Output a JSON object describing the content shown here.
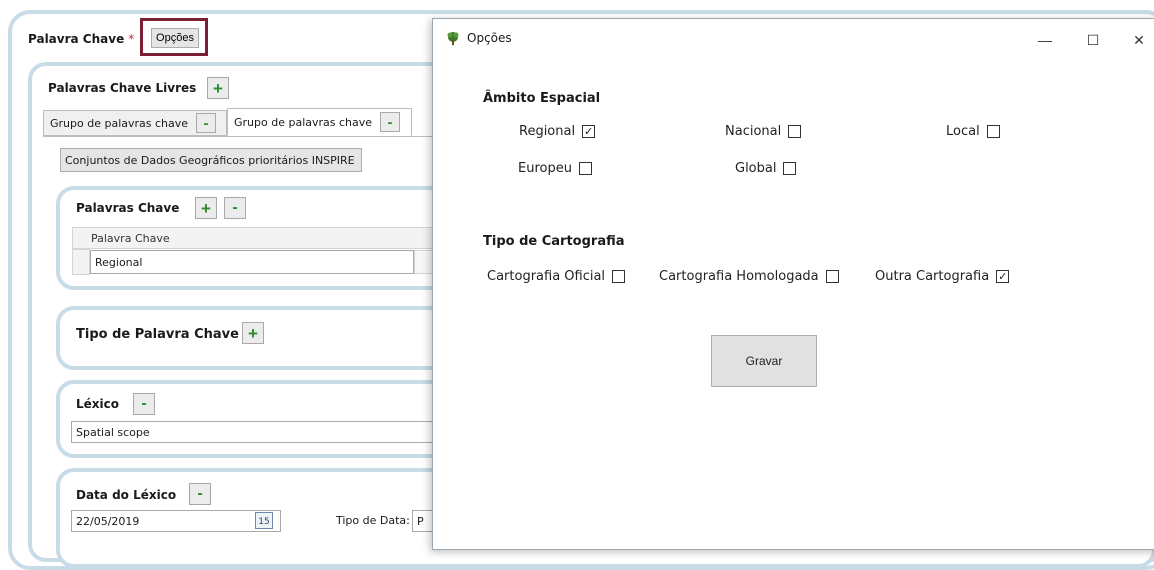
{
  "form": {
    "header_label": "Palavra Chave",
    "required_mark": "*",
    "options_button": "Opções",
    "free_keywords": {
      "title": "Palavras Chave Livres",
      "plus": "+",
      "tabs": [
        {
          "label": "Grupo de palavras chave",
          "minus": "-"
        },
        {
          "label": "Grupo de palavras chave",
          "minus": "-"
        }
      ],
      "inspire_button": "Conjuntos de Dados Geográficos prioritários INSPIRE",
      "keywords": {
        "title": "Palavras Chave",
        "plus": "+",
        "minus": "-",
        "column_header": "Palavra Chave",
        "rows": [
          "Regional"
        ]
      },
      "keyword_type": {
        "title": "Tipo de Palavra Chave",
        "plus": "+"
      },
      "lexicon": {
        "title": "Léxico",
        "minus": "-",
        "value": "Spatial scope"
      },
      "lexicon_date": {
        "title": "Data do Léxico",
        "minus": "-",
        "date_value": "22/05/2019",
        "calendar_day": "15",
        "date_type_label": "Tipo de Data:",
        "date_type_value": "P"
      }
    }
  },
  "dialog": {
    "title": "Opções",
    "controls": {
      "minimize": "—",
      "maximize": "☐",
      "close": "✕"
    },
    "spatial_scope": {
      "title": "Âmbito Espacial",
      "options": [
        {
          "label": "Regional",
          "checked": true,
          "check": "✓"
        },
        {
          "label": "Nacional",
          "checked": false,
          "check": ""
        },
        {
          "label": "Local",
          "checked": false,
          "check": ""
        },
        {
          "label": "Europeu",
          "checked": false,
          "check": ""
        },
        {
          "label": "Global",
          "checked": false,
          "check": ""
        }
      ]
    },
    "cartography_type": {
      "title": "Tipo de Cartografia",
      "options": [
        {
          "label": "Cartografia Oficial",
          "checked": false,
          "check": ""
        },
        {
          "label": "Cartografia Homologada",
          "checked": false,
          "check": ""
        },
        {
          "label": "Outra Cartografia",
          "checked": true,
          "check": "✓"
        }
      ]
    },
    "save_button": "Gravar"
  },
  "colors": {
    "panel_border": "#c8dce8",
    "highlight_border": "#7a1f33",
    "plus_green": "#2e8b2e",
    "required_red": "#d6212e"
  }
}
